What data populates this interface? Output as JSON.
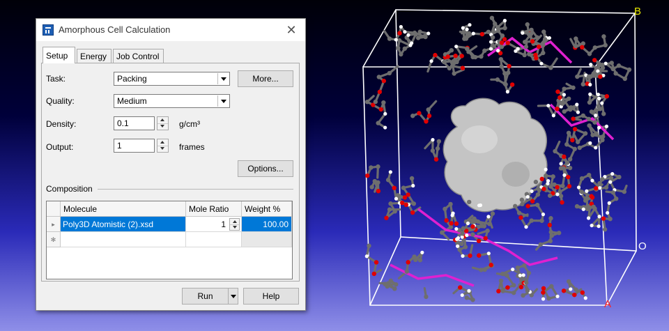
{
  "dialog": {
    "title": "Amorphous Cell Calculation",
    "close_glyph": "✕",
    "tabs": [
      {
        "label": "Setup",
        "active": true
      },
      {
        "label": "Energy",
        "active": false
      },
      {
        "label": "Job Control",
        "active": false
      }
    ],
    "task": {
      "label": "Task:",
      "value": "Packing"
    },
    "more_button": "More...",
    "quality": {
      "label": "Quality:",
      "value": "Medium"
    },
    "density": {
      "label": "Density:",
      "value": "0.1",
      "unit": "g/cm³"
    },
    "output": {
      "label": "Output:",
      "value": "1",
      "unit": "frames"
    },
    "options_button": "Options...",
    "composition": {
      "label": "Composition",
      "columns": [
        "Molecule",
        "Mole Ratio",
        "Weight %"
      ],
      "rows": [
        {
          "indicator": "▸",
          "molecule": "Poly3D Atomistic (2).xsd",
          "mole_ratio": "1",
          "weight": "100.00"
        },
        {
          "indicator": "✻",
          "molecule": "",
          "mole_ratio": "",
          "weight": ""
        }
      ]
    },
    "run_button": "Run",
    "help_button": "Help"
  },
  "viewport": {
    "axis_labels": {
      "b": "B",
      "origin": "O",
      "a": "A"
    },
    "colors": {
      "b_axis": "#e8e800",
      "a_axis": "#ff2020",
      "origin": "#ffffff",
      "carbon": "#6e6e6e",
      "oxygen": "#e00000",
      "hydrogen": "#ffffff",
      "highlight": "#e020d0",
      "surface": "#c8c8c8"
    }
  }
}
